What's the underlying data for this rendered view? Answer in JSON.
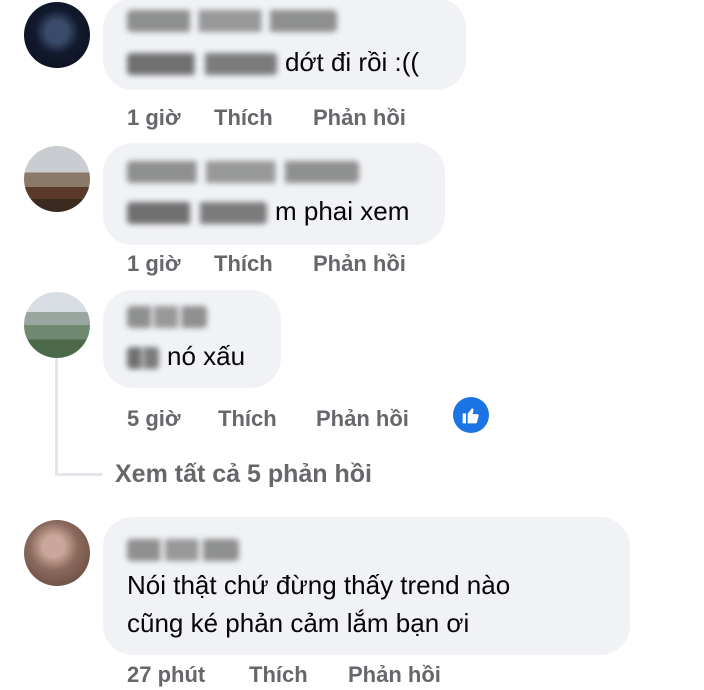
{
  "comments": [
    {
      "text": "dớt đi rồi :((",
      "time": "1 giờ",
      "like_label": "Thích",
      "reply_label": "Phản hồi"
    },
    {
      "text": "m phai xem",
      "time": "1 giờ",
      "like_label": "Thích",
      "reply_label": "Phản hồi"
    },
    {
      "text": "nó xấu",
      "time": "5 giờ",
      "like_label": "Thích",
      "reply_label": "Phản hồi",
      "reaction_icon": "like-icon"
    },
    {
      "text_line1": "Nói thật chứ đừng thấy trend nào",
      "text_line2": "cũng ké phản cảm lắm bạn ơi",
      "time": "27 phút",
      "like_label": "Thích",
      "reply_label": "Phản hồi"
    }
  ],
  "see_all_replies": "Xem tất cả 5 phản hồi",
  "colors": {
    "bubble": "#f0f2f5",
    "meta_text": "#65676b",
    "like_blue": "#1b74e4"
  }
}
